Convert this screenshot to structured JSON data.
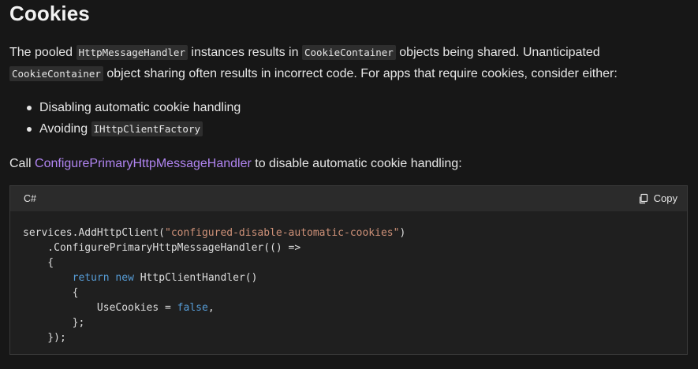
{
  "heading": "Cookies",
  "intro": {
    "t1": "The pooled ",
    "c1": "HttpMessageHandler",
    "t2": " instances results in ",
    "c2": "CookieContainer",
    "t3": " objects being shared. Unanticipated",
    "c3": "CookieContainer",
    "t4": " object sharing often results in incorrect code. For apps that require cookies, consider either:"
  },
  "bullets": {
    "item1": "Disabling automatic cookie handling",
    "item2_text": "Avoiding ",
    "item2_code": "IHttpClientFactory"
  },
  "call": {
    "t1": "Call ",
    "link": "ConfigurePrimaryHttpMessageHandler",
    "t2": " to disable automatic cookie handling:"
  },
  "codeblock": {
    "language": "C#",
    "copy_label": "Copy",
    "lines": {
      "l1a": "services.AddHttpClient(",
      "l1s": "\"configured-disable-automatic-cookies\"",
      "l1b": ")",
      "l2": "    .ConfigurePrimaryHttpMessageHandler(() =>",
      "l3": "    {",
      "l4a": "        ",
      "l4k1": "return",
      "l4b": " ",
      "l4k2": "new",
      "l4c": " HttpClientHandler()",
      "l5": "        {",
      "l6a": "            UseCookies = ",
      "l6k": "false",
      "l6b": ",",
      "l7": "        };",
      "l8": "    });"
    }
  },
  "colors": {
    "background": "#171717",
    "link": "#b084f0",
    "string": "#ce9178",
    "keyword": "#569cd6"
  }
}
